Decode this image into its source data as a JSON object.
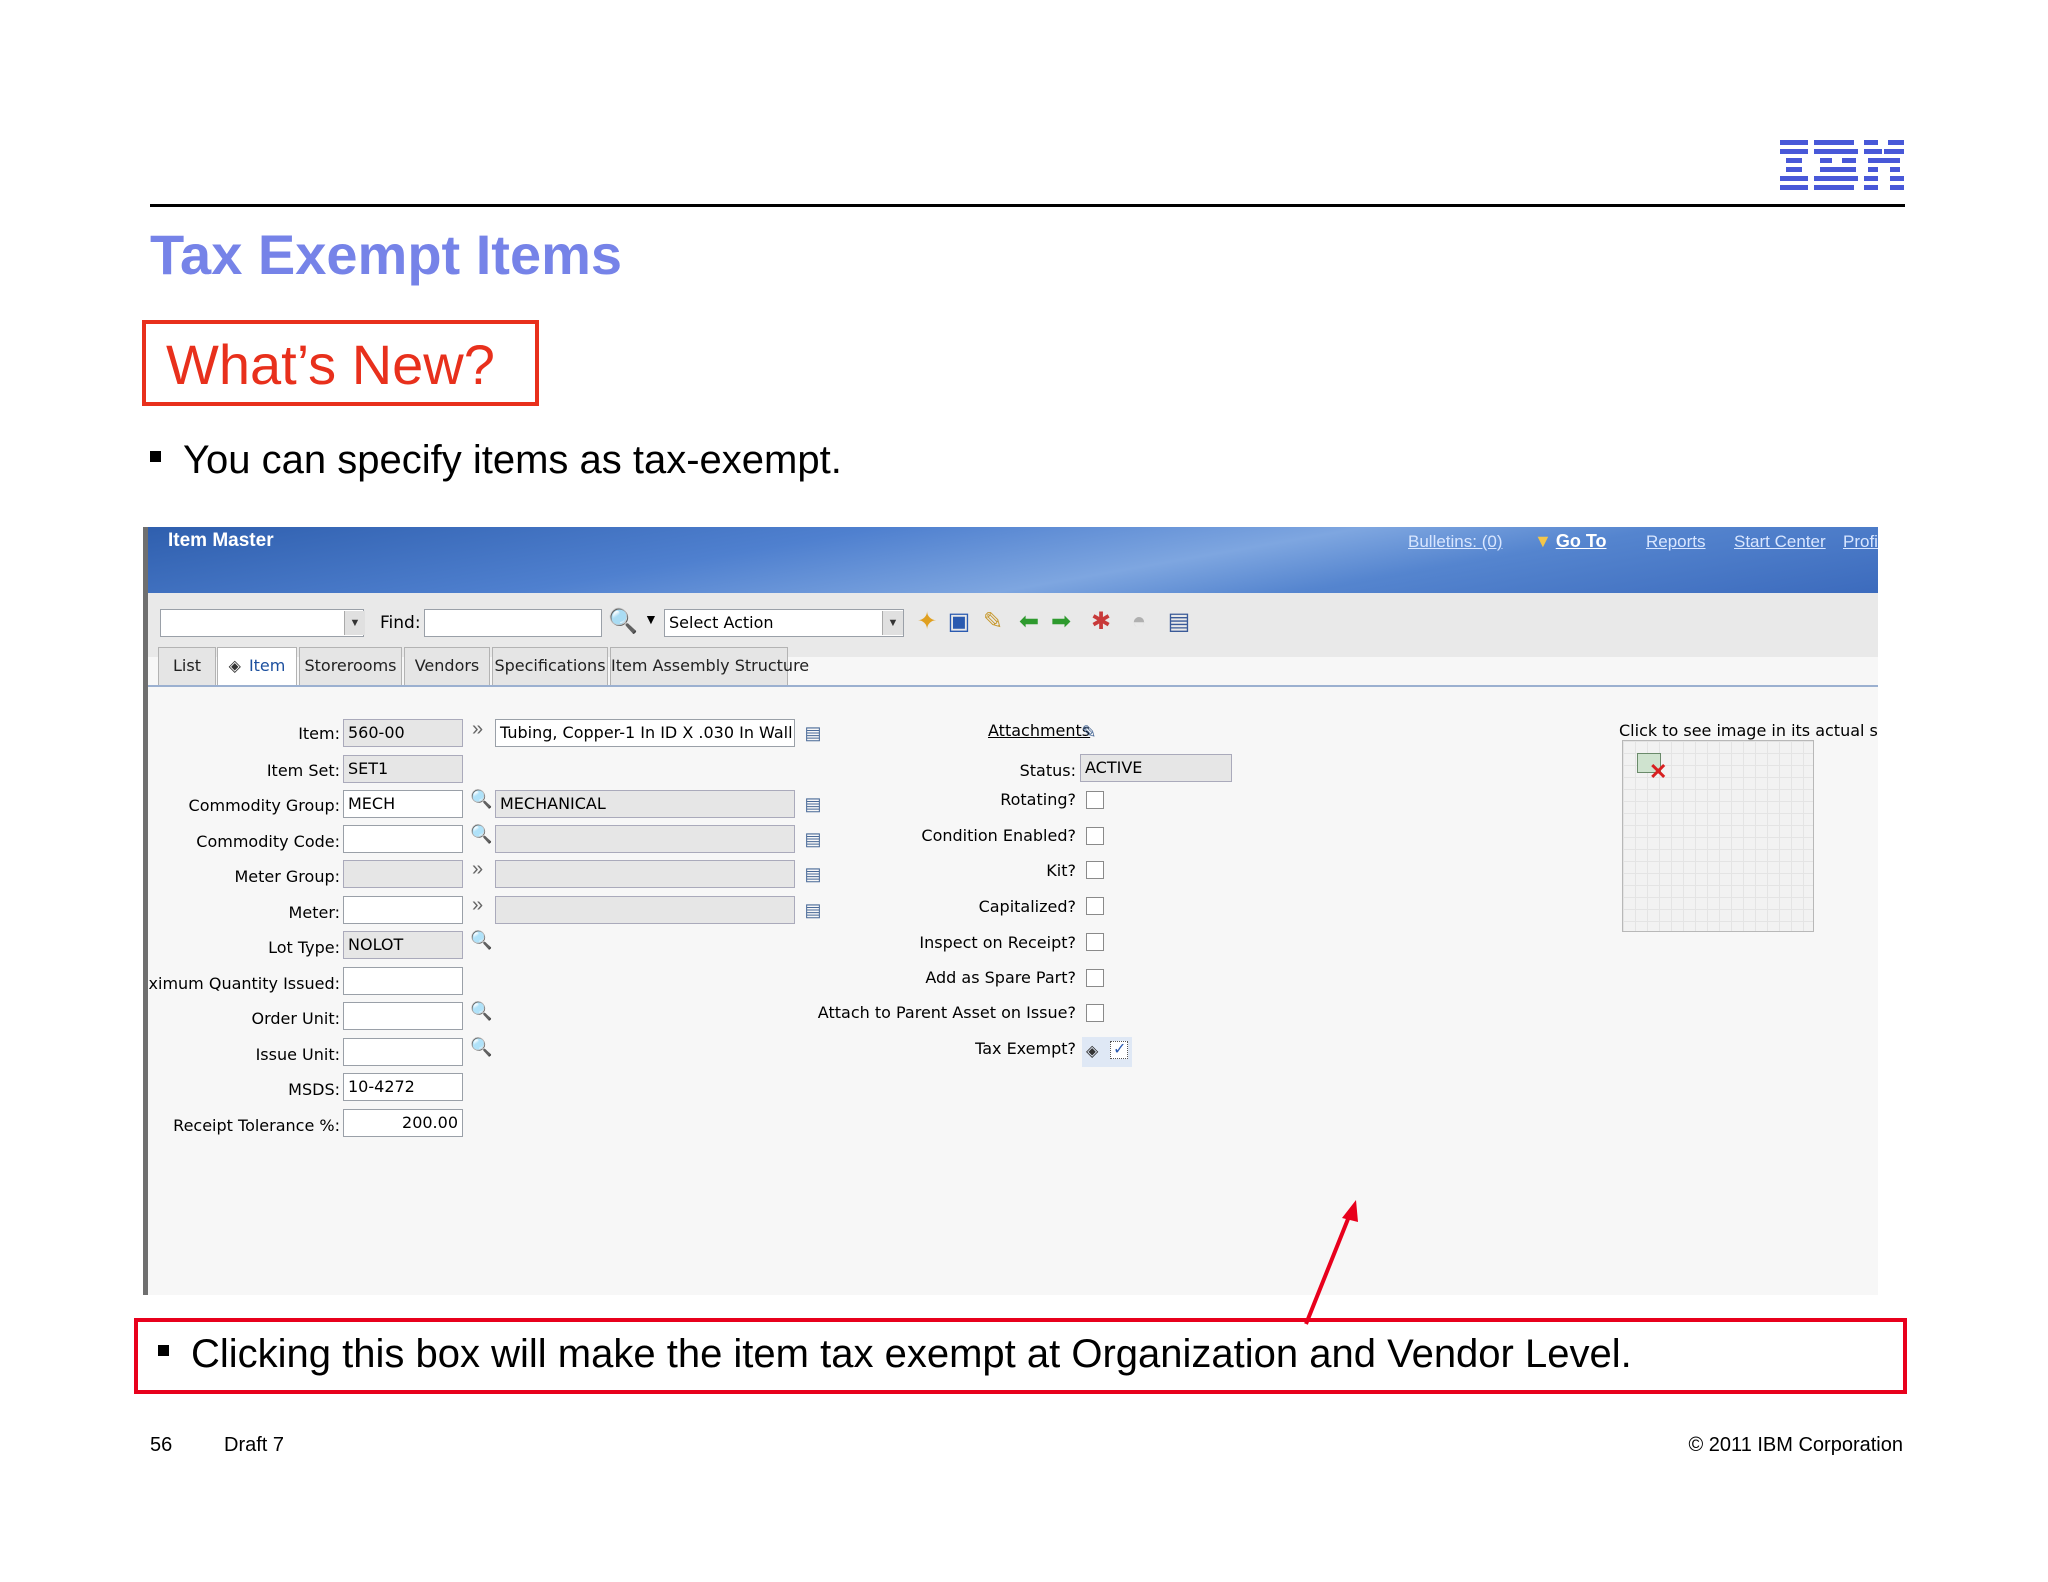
{
  "slide": {
    "title": "Tax Exempt Items",
    "whats_new": "What’s New?",
    "bullet_1": "You can specify items as tax-exempt.",
    "callout": "Clicking this box will make the item tax exempt at Organization and Vendor Level.",
    "page_number": "56",
    "draft": "Draft 7",
    "copyright": "© 2011 IBM Corporation",
    "logo": "IBM"
  },
  "app": {
    "title": "Item Master",
    "header_links": {
      "bulletins": "Bulletins: (0)",
      "goto": "Go To",
      "reports": "Reports",
      "start_center": "Start Center",
      "profile": "Profi"
    },
    "toolbar": {
      "find_label": "Find:",
      "find_value": "",
      "select_action": "Select Action"
    },
    "tabs": [
      "List",
      "Item",
      "Storerooms",
      "Vendors",
      "Specifications",
      "Item Assembly Structure"
    ],
    "fields": {
      "item": {
        "label": "Item:",
        "value": "560-00",
        "description": "Tubing, Copper-1 In ID X .030 In Wall"
      },
      "item_set": {
        "label": "Item Set:",
        "value": "SET1"
      },
      "commodity_group": {
        "label": "Commodity Group:",
        "value": "MECH",
        "description": "MECHANICAL"
      },
      "commodity_code": {
        "label": "Commodity Code:",
        "value": "",
        "description": ""
      },
      "meter_group": {
        "label": "Meter Group:",
        "value": "",
        "description": ""
      },
      "meter": {
        "label": "Meter:",
        "value": "",
        "description": ""
      },
      "lot_type": {
        "label": "Lot Type:",
        "value": "NOLOT"
      },
      "max_qty_issued": {
        "label": "Maximum Quantity Issued:",
        "value": ""
      },
      "order_unit": {
        "label": "Order Unit:",
        "value": ""
      },
      "issue_unit": {
        "label": "Issue Unit:",
        "value": ""
      },
      "msds": {
        "label": "MSDS:",
        "value": "10-4272"
      },
      "receipt_tolerance": {
        "label": "Receipt Tolerance %:",
        "value": "200.00"
      }
    },
    "right": {
      "attachments": "Attachments",
      "status_label": "Status:",
      "status_value": "ACTIVE",
      "image_caption": "Click to see image in its actual size",
      "checkboxes": [
        {
          "label": "Rotating?",
          "checked": false
        },
        {
          "label": "Condition Enabled?",
          "checked": false
        },
        {
          "label": "Kit?",
          "checked": false
        },
        {
          "label": "Capitalized?",
          "checked": false
        },
        {
          "label": "Inspect on Receipt?",
          "checked": false
        },
        {
          "label": "Add as Spare Part?",
          "checked": false
        },
        {
          "label": "Attach to Parent Asset on Issue?",
          "checked": false
        },
        {
          "label": "Tax Exempt?",
          "checked": true
        }
      ]
    }
  },
  "colors": {
    "title_blue": "#7683e8",
    "callout_red": "#e8001c",
    "header_blue": "#4f80cf"
  },
  "icons": [
    "search-icon",
    "new-record-icon",
    "save-icon",
    "clear-icon",
    "previous-arrow-icon",
    "next-arrow-icon",
    "workflow-icon",
    "route-icon",
    "report-icon",
    "detail-menu-icon",
    "lookup-icon",
    "help-icon",
    "attachment-icon",
    "broken-image-icon"
  ]
}
